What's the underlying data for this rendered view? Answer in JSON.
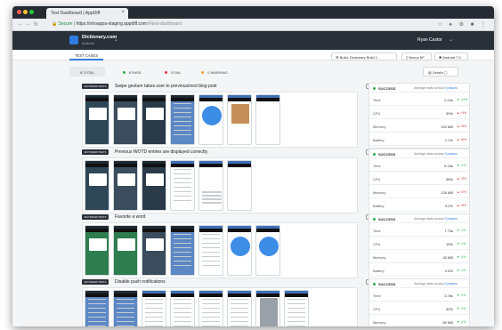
{
  "browser": {
    "tab_title": "Test Dashboard | AppDiff",
    "url_secure": "Secure",
    "url_host": "https://ohoappa-staging.appdiff.com",
    "url_path": "/#/test-dashboard"
  },
  "app": {
    "name": "Dictionary.com",
    "sub": "Android",
    "user": "Ryan Castor"
  },
  "nav": {
    "test_cases_tab": "TEST CASES"
  },
  "toolbar": {
    "build": "Build: Dictionary Build 1",
    "device": "Nexus 6P",
    "os": "Android 7.0"
  },
  "filters": {
    "total": "8 TOTAL",
    "pass": "8 PASS",
    "fail": "0 FAIL",
    "warning": "0 WARNING",
    "details": "Details"
  },
  "cases": [
    {
      "badge": "DICTIONARY.TESTS",
      "title": "Swipe gesture takes user to previous/next blog post",
      "status": "SUCCESS",
      "avg_label": "Average stats across",
      "avg_count": "9 passes",
      "stats": [
        {
          "label": "Time",
          "value": "2.24s",
          "delta": "▼ -13%"
        },
        {
          "label": "CPU",
          "value": "39%",
          "delta": "▲ +3%"
        },
        {
          "label": "Memory",
          "value": "130 MB",
          "delta": "▲ +5%"
        },
        {
          "label": "Battery",
          "value": "1.1%",
          "delta": "▲ +6%"
        }
      ]
    },
    {
      "badge": "DICTIONARY.TESTS",
      "title": "Previous WOTD entries are displayed correctly.",
      "status": "SUCCESS",
      "avg_label": "Average stats across",
      "avg_count": "9 passes",
      "stats": [
        {
          "label": "Time",
          "value": "8.15s",
          "delta": "▼ -1%"
        },
        {
          "label": "CPU",
          "value": "38%",
          "delta": "▲ +3%"
        },
        {
          "label": "Memory",
          "value": "126 MB",
          "delta": "▲ +2%"
        },
        {
          "label": "Battery",
          "value": "3.2%",
          "delta": "▲ +5%"
        }
      ]
    },
    {
      "badge": "DICTIONARY.TESTS",
      "title": "Favorite a word",
      "status": "SUCCESS",
      "avg_label": "Average stats across",
      "avg_count": "9 passes",
      "stats": [
        {
          "label": "Time",
          "value": "7.73s",
          "delta": "▼ -1%"
        },
        {
          "label": "CPU",
          "value": "15%",
          "delta": "▼ -1%"
        },
        {
          "label": "Memory",
          "value": "33 MB",
          "delta": "▼ -1%"
        },
        {
          "label": "Battery",
          "value": "2.6%",
          "delta": "▼ -1%"
        }
      ]
    },
    {
      "badge": "DICTIONARY.TESTS",
      "title": "Disable push notifications",
      "status": "SUCCESS",
      "avg_label": "Average stats across",
      "avg_count": "9 passes",
      "stats": [
        {
          "label": "Time",
          "value": "3.78s",
          "delta": "▼ -1%"
        },
        {
          "label": "CPU",
          "value": "32%",
          "delta": "▼ -1%"
        },
        {
          "label": "Memory",
          "value": "80 MB",
          "delta": "▼ -1%"
        }
      ]
    }
  ]
}
